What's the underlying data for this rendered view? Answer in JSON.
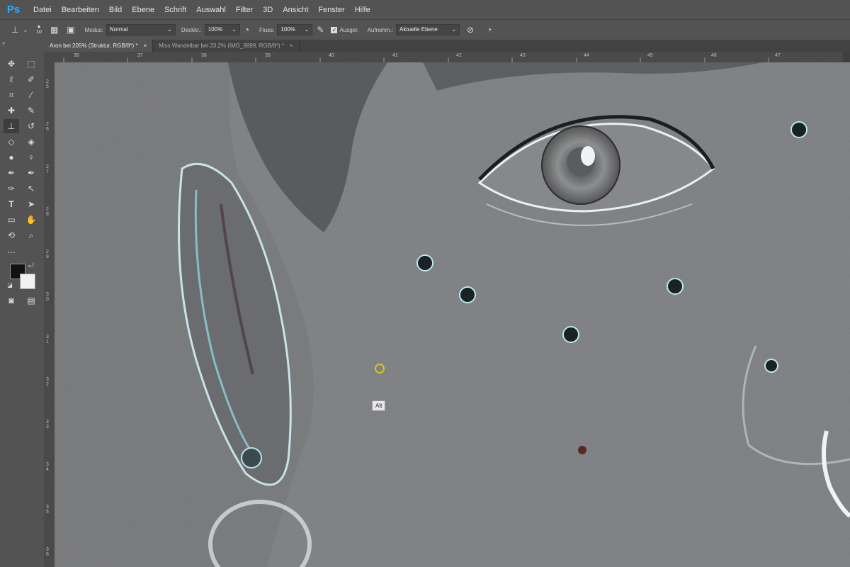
{
  "menubar": {
    "logo": "Ps",
    "items": [
      "Datei",
      "Bearbeiten",
      "Bild",
      "Ebene",
      "Schrift",
      "Auswahl",
      "Filter",
      "3D",
      "Ansicht",
      "Fenster",
      "Hilfe"
    ]
  },
  "options": {
    "brush_size": "10",
    "modus_label": "Modus:",
    "modus_value": "Normal",
    "deckkr_label": "Deckkr.:",
    "deckkr_value": "100%",
    "fluss_label": "Fluss:",
    "fluss_value": "100%",
    "ausger_label": "Ausger.",
    "aufnehm_label": "Aufnehm.:",
    "aufnehm_value": "Aktuelle Ebene"
  },
  "tabs": [
    {
      "label": "Aron bei 205% (Struktur, RGB/8*) *",
      "active": true
    },
    {
      "label": "Miss Wandelbar bei 23,2% (IMG_9899, RGB/8*) *",
      "active": false
    }
  ],
  "ruler_h_labels": [
    "36",
    "37",
    "38",
    "39",
    "40",
    "41",
    "42",
    "43",
    "44",
    "45",
    "46",
    "47"
  ],
  "ruler_v_labels": [
    "2\n5",
    "2\n6",
    "2\n7",
    "2\n8",
    "2\n9",
    "3\n0",
    "3\n1",
    "3\n2",
    "3\n3",
    "3\n4",
    "3\n5",
    "3\n6"
  ],
  "tooltip": "Alt",
  "colors": {
    "accent": "#31a8ff",
    "panel": "#535353",
    "foreground": "#111111",
    "background": "#f2f2f2"
  },
  "icons": [
    "move-icon",
    "marquee-icon",
    "lasso-icon",
    "quick-select-icon",
    "crop-icon",
    "eyedropper-icon",
    "healing-icon",
    "brush-icon",
    "clone-stamp-icon",
    "history-brush-icon",
    "eraser-icon",
    "paint-bucket-icon",
    "blur-icon",
    "dodge-icon",
    "pen-icon",
    "type-icon",
    "path-select-icon",
    "rectangle-icon",
    "hand-icon",
    "zoom-icon"
  ]
}
